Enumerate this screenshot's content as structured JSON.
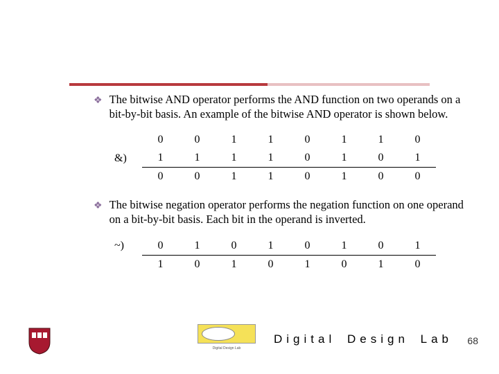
{
  "bullets": [
    "The bitwise AND operator performs the AND function on two operands on a bit-by-bit basis. An example of the bitwise AND operator is shown below.",
    "The bitwise negation operator performs the negation function on one operand on a bit-by-bit basis. Each bit in the operand is inverted."
  ],
  "and_table": {
    "op": "&)",
    "rows": [
      [
        "0",
        "0",
        "1",
        "1",
        "0",
        "1",
        "1",
        "0"
      ],
      [
        "1",
        "1",
        "1",
        "1",
        "0",
        "1",
        "0",
        "1"
      ],
      [
        "0",
        "0",
        "1",
        "1",
        "0",
        "1",
        "0",
        "0"
      ]
    ]
  },
  "not_table": {
    "op": "~)",
    "rows": [
      [
        "0",
        "1",
        "0",
        "1",
        "0",
        "1",
        "0",
        "1"
      ],
      [
        "1",
        "0",
        "1",
        "0",
        "1",
        "0",
        "1",
        "0"
      ]
    ]
  },
  "footer": {
    "logo_sub": "Digital Design Lab",
    "lab_text_1": "Digital",
    "lab_text_2": "Design",
    "lab_text_3": "Lab",
    "page": "68"
  }
}
